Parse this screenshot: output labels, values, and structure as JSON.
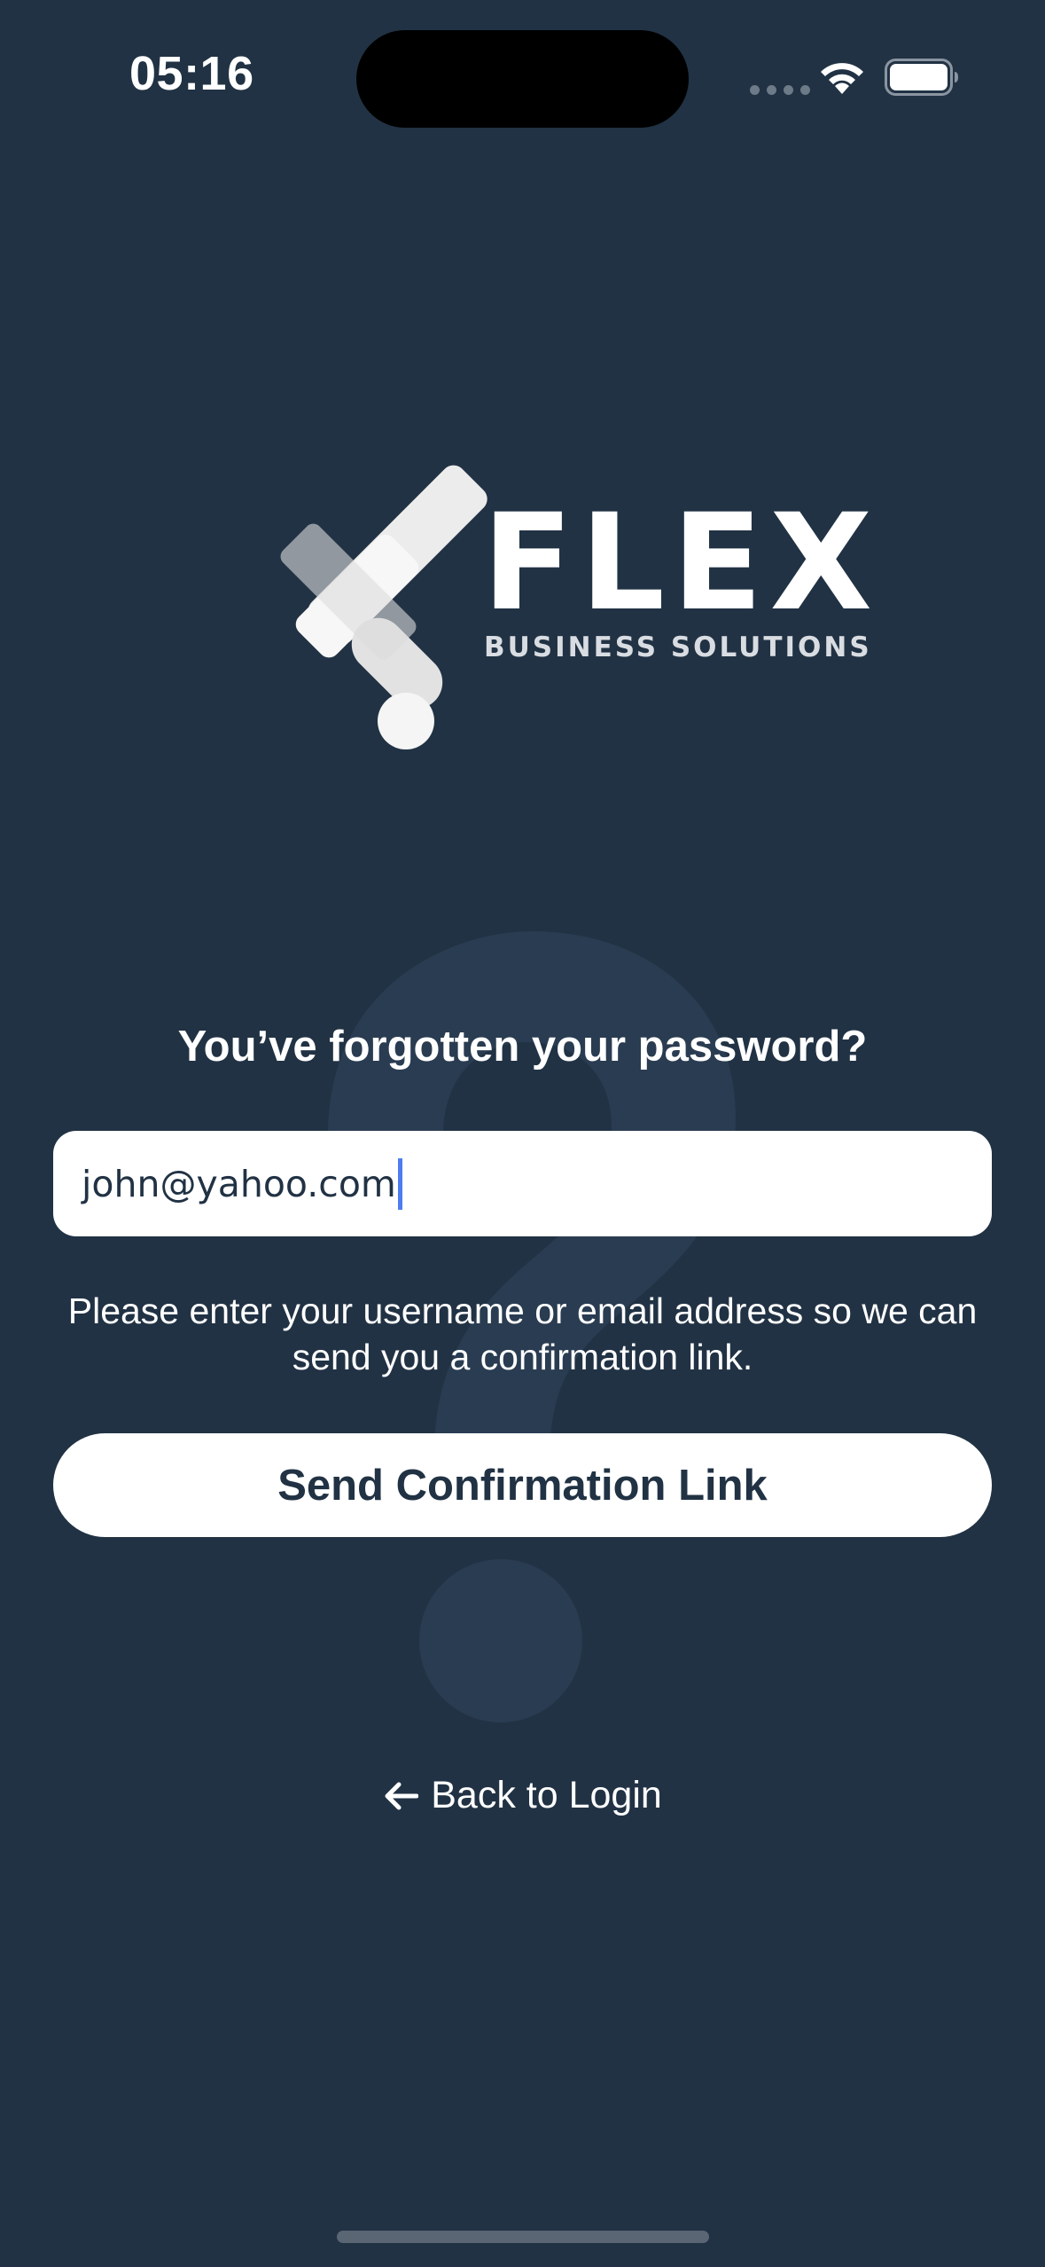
{
  "status_bar": {
    "time": "05:16",
    "icons": [
      "signal-dots-icon",
      "wifi-icon",
      "battery-icon"
    ]
  },
  "logo": {
    "wordmark": "FLEX",
    "tagline": "BUSINESS SOLUTIONS"
  },
  "form": {
    "title": "You’ve forgotten your password?",
    "email_value": "john@yahoo.com",
    "helper_text": "Please enter your username or email address so we can send you a confirmation link.",
    "send_button_label": "Send Confirmation Link"
  },
  "footer": {
    "back_link_label": "Back to Login"
  },
  "colors": {
    "background": "#213244",
    "text": "#ffffff",
    "button_text": "#213244",
    "caret": "#4f7df0"
  }
}
